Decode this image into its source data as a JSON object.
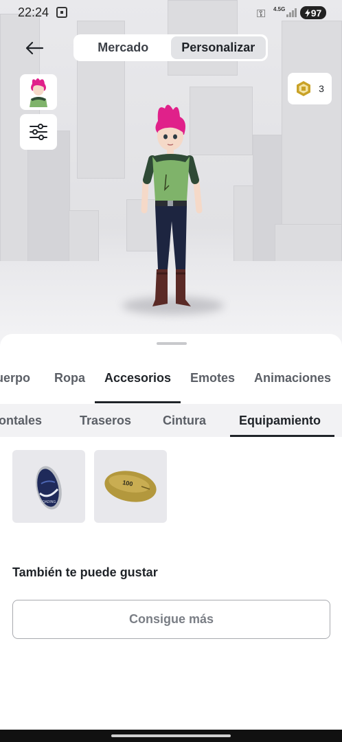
{
  "status_bar": {
    "time": "22:24",
    "network": "4.5G",
    "battery": "97",
    "icons": [
      "screen-record-icon",
      "key-icon",
      "signal-icon",
      "battery-charging-icon"
    ]
  },
  "header": {
    "back_icon": "arrow-left-icon",
    "segments": [
      {
        "label": "Mercado",
        "active": false
      },
      {
        "label": "Personalizar",
        "active": true
      }
    ]
  },
  "side_buttons": {
    "avatar_thumb_icon": "avatar-thumbnail-icon",
    "filter_icon": "sliders-icon"
  },
  "robux": {
    "icon": "robux-icon",
    "count": "3"
  },
  "tabs": {
    "items": [
      "uerpo",
      "Ropa",
      "Accesorios",
      "Emotes",
      "Animaciones"
    ],
    "active": "Accesorios"
  },
  "subtabs": {
    "items": [
      "ontales",
      "Traseros",
      "Cintura",
      "Equipamiento"
    ],
    "active": "Equipamiento"
  },
  "items": [
    {
      "icon": "egg-gear-icon",
      "label": "LOADING"
    },
    {
      "icon": "football-gear-icon",
      "label": "100"
    }
  ],
  "recommendations": {
    "title": "También te puede gustar",
    "button": "Consigue más"
  },
  "colors": {
    "accent": "#1f2328",
    "hair": "#e0218a",
    "shirt": "#7fb36a",
    "robux": "#c9a227"
  }
}
